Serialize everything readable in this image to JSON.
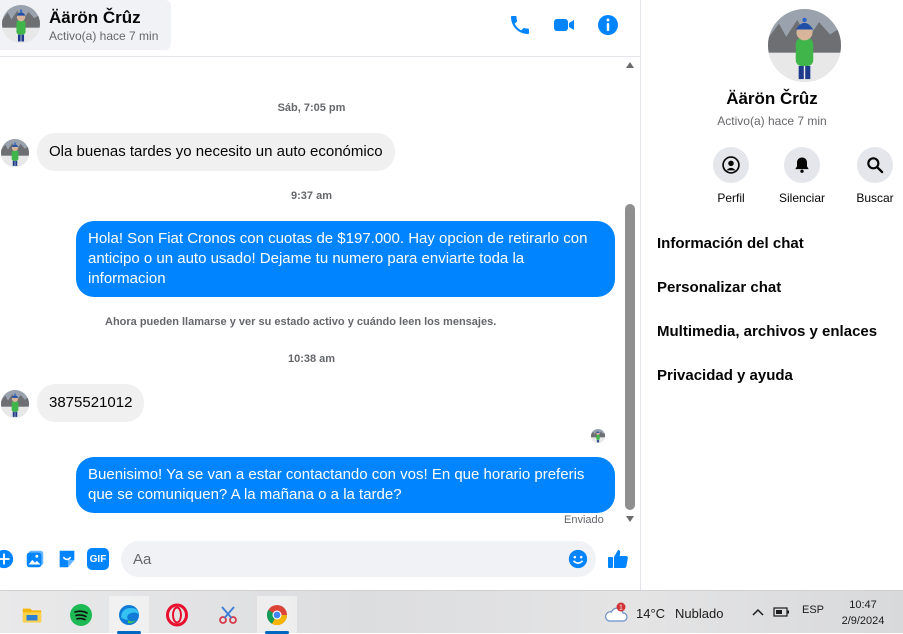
{
  "contact": {
    "name": "Äärön Črûz",
    "status": "Activo(a) hace 7 min"
  },
  "colors": {
    "accent": "#0084ff",
    "incoming_bubble": "#f0f0f0",
    "secondary_text": "#65676b"
  },
  "header_icons": [
    "phone-icon",
    "video-camera-icon",
    "info-icon"
  ],
  "messages": {
    "ts1": "Sáb, 7:05 pm",
    "in1": "Ola buenas tardes yo necesito un auto económico",
    "ts2": "9:37 am",
    "out1": "Hola! Son Fiat Cronos con cuotas de $197.000. Hay opcion de retirarlo con anticipo o un auto usado! Dejame tu numero para enviarte toda la informacion",
    "notice": "Ahora pueden llamarse y ver su estado activo y cuándo leen los mensajes.",
    "ts3": "10:38 am",
    "in2": "3875521012",
    "out2": "Buenisimo! Ya se van a estar contactando con vos! En que horario preferis que se comuniquen? A la mañana o a la tarde?",
    "sent_label": "Enviado"
  },
  "composer": {
    "placeholder": "Aa",
    "icons": [
      "plus-icon",
      "image-icon",
      "sticker-icon",
      "gif-icon",
      "emoji-icon",
      "thumbs-up-icon"
    ],
    "gif_label": "GIF"
  },
  "info_pane": {
    "actions": [
      {
        "label": "Perfil",
        "icon": "profile-icon"
      },
      {
        "label": "Silenciar",
        "icon": "bell-icon"
      },
      {
        "label": "Buscar",
        "icon": "search-icon"
      }
    ],
    "menu": [
      "Información del chat",
      "Personalizar chat",
      "Multimedia, archivos y enlaces",
      "Privacidad y ayuda"
    ]
  },
  "taskbar": {
    "apps": [
      "file-explorer",
      "spotify",
      "edge",
      "opera",
      "snipping-tool",
      "chrome"
    ],
    "weather": {
      "temp": "14°C",
      "condition": "Nublado",
      "badge": "1"
    },
    "language": "ESP",
    "time": "10:47",
    "date": "2/9/2024"
  }
}
